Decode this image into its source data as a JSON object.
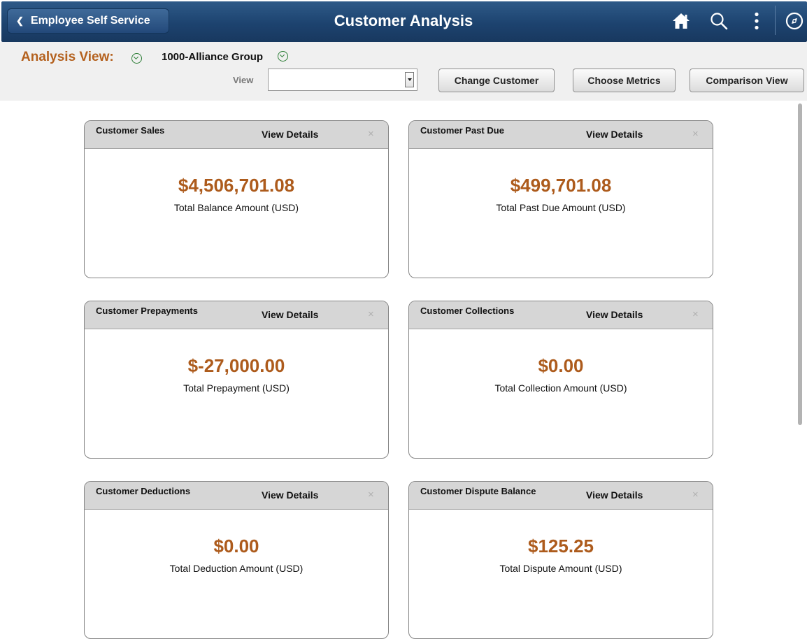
{
  "header": {
    "back_label": "Employee Self Service",
    "title": "Customer Analysis",
    "icons": [
      "home-icon",
      "search-icon",
      "more-options-icon",
      "navbar-compass-icon"
    ]
  },
  "toolbar": {
    "analysis_view_label": "Analysis View:",
    "group_label": "1000-Alliance Group",
    "view_label": "View",
    "view_value": "",
    "buttons": {
      "change_customer": "Change Customer",
      "choose_metrics": "Choose Metrics",
      "comparison_view": "Comparison View"
    }
  },
  "tiles": [
    {
      "title": "Customer Sales",
      "link": "View Details",
      "close": "×",
      "amount": "$4,506,701.08",
      "caption": "Total Balance Amount (USD)"
    },
    {
      "title": "Customer Past Due",
      "link": "View Details",
      "close": "×",
      "amount": "$499,701.08",
      "caption": "Total Past Due Amount (USD)"
    },
    {
      "title": "Customer Prepayments",
      "link": "View Details",
      "close": "×",
      "amount": "$-27,000.00",
      "caption": "Total Prepayment  (USD)"
    },
    {
      "title": "Customer Collections",
      "link": "View Details",
      "close": "×",
      "amount": "$0.00",
      "caption": "Total Collection Amount (USD)"
    },
    {
      "title": "Customer Deductions",
      "link": "View Details",
      "close": "×",
      "amount": "$0.00",
      "caption": "Total Deduction Amount (USD)"
    },
    {
      "title": "Customer Dispute Balance",
      "link": "View Details",
      "close": "×",
      "amount": "$125.25",
      "caption": "Total Dispute Amount (USD)"
    }
  ],
  "colors": {
    "header_bar": "#1d436f",
    "accent_orange": "#b4611e",
    "amount_color": "#ad5b1c",
    "dropdown_icon_green": "#2b7d35",
    "toolbar_bg": "#f0f0f0",
    "tile_header_bg": "#d6d6d6"
  }
}
